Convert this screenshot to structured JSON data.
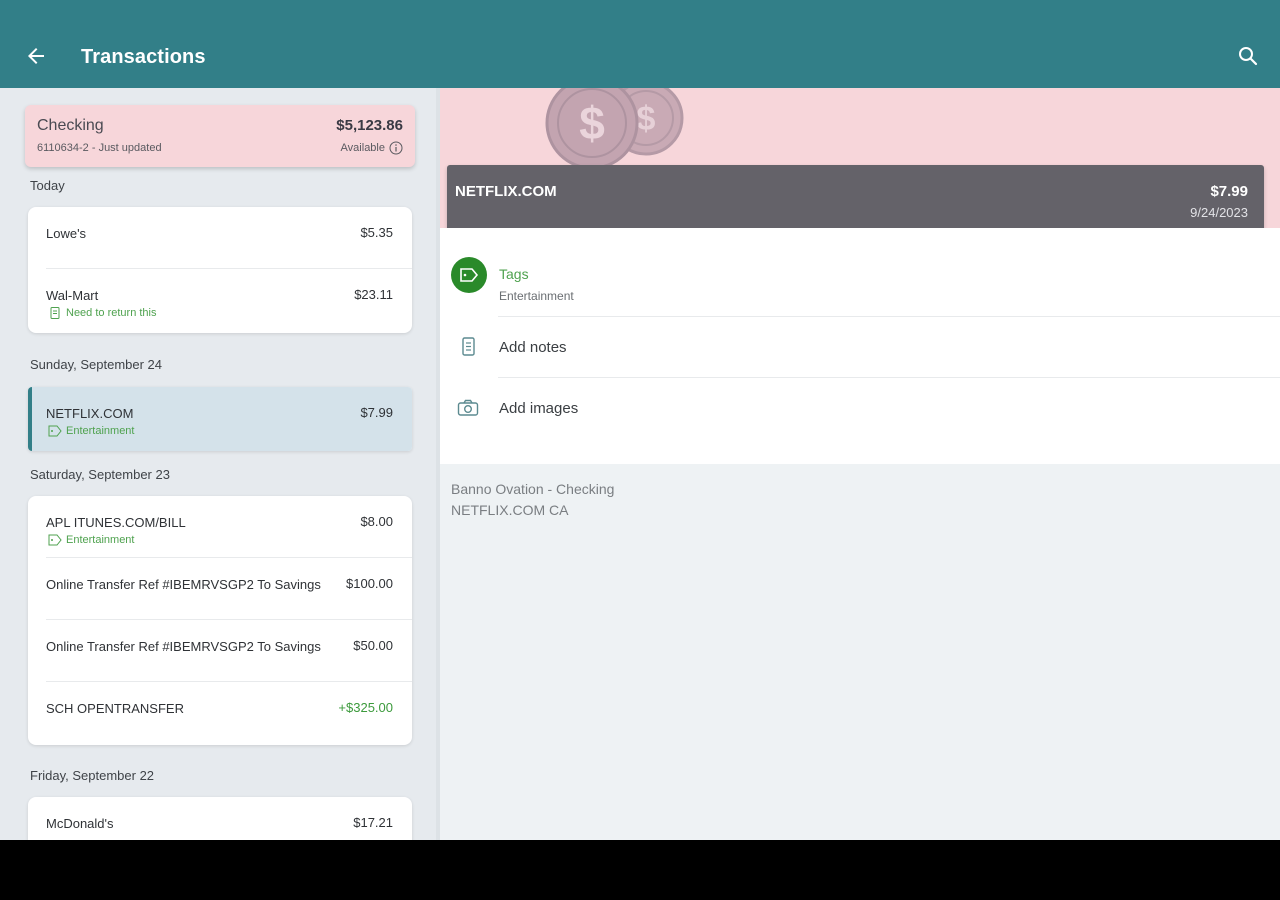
{
  "app_bar": {
    "title": "Transactions",
    "back_icon": "arrow-left-icon",
    "search_icon": "search-icon",
    "color": "#327f88"
  },
  "account": {
    "name": "Checking",
    "subtitle": "6110634-2 - Just updated",
    "balance": "$5,123.86",
    "balance_label": "Available"
  },
  "groups": [
    {
      "label": "Today",
      "items": [
        {
          "name": "Lowe's",
          "amount": "$5.35"
        },
        {
          "name": "Wal-Mart",
          "amount": "$23.11",
          "note": "Need to return this"
        }
      ]
    },
    {
      "label": "Sunday, September 24",
      "items": [
        {
          "name": "NETFLIX.COM",
          "amount": "$7.99",
          "tag": "Entertainment",
          "selected": true
        }
      ]
    },
    {
      "label": "Saturday, September 23",
      "items": [
        {
          "name": "APL ITUNES.COM/BILL",
          "amount": "$8.00",
          "tag": "Entertainment"
        },
        {
          "name": "Online Transfer Ref #IBEMRVSGP2 To Savings",
          "amount": "$100.00"
        },
        {
          "name": "Online Transfer Ref #IBEMRVSGP2 To Savings",
          "amount": "$50.00"
        },
        {
          "name": "SCH OPENTRANSFER",
          "amount": "+$325.00"
        }
      ]
    },
    {
      "label": "Friday, September 22",
      "items": [
        {
          "name": "McDonald's",
          "amount": "$17.21"
        }
      ]
    }
  ],
  "detail": {
    "merchant": "NETFLIX.COM",
    "amount": "$7.99",
    "date": "9/24/2023",
    "tags_label": "Tags",
    "tags_value": "Entertainment",
    "add_notes": "Add notes",
    "add_images": "Add images",
    "account_line": "Banno Ovation - Checking",
    "description_line": "NETFLIX.COM CA"
  }
}
